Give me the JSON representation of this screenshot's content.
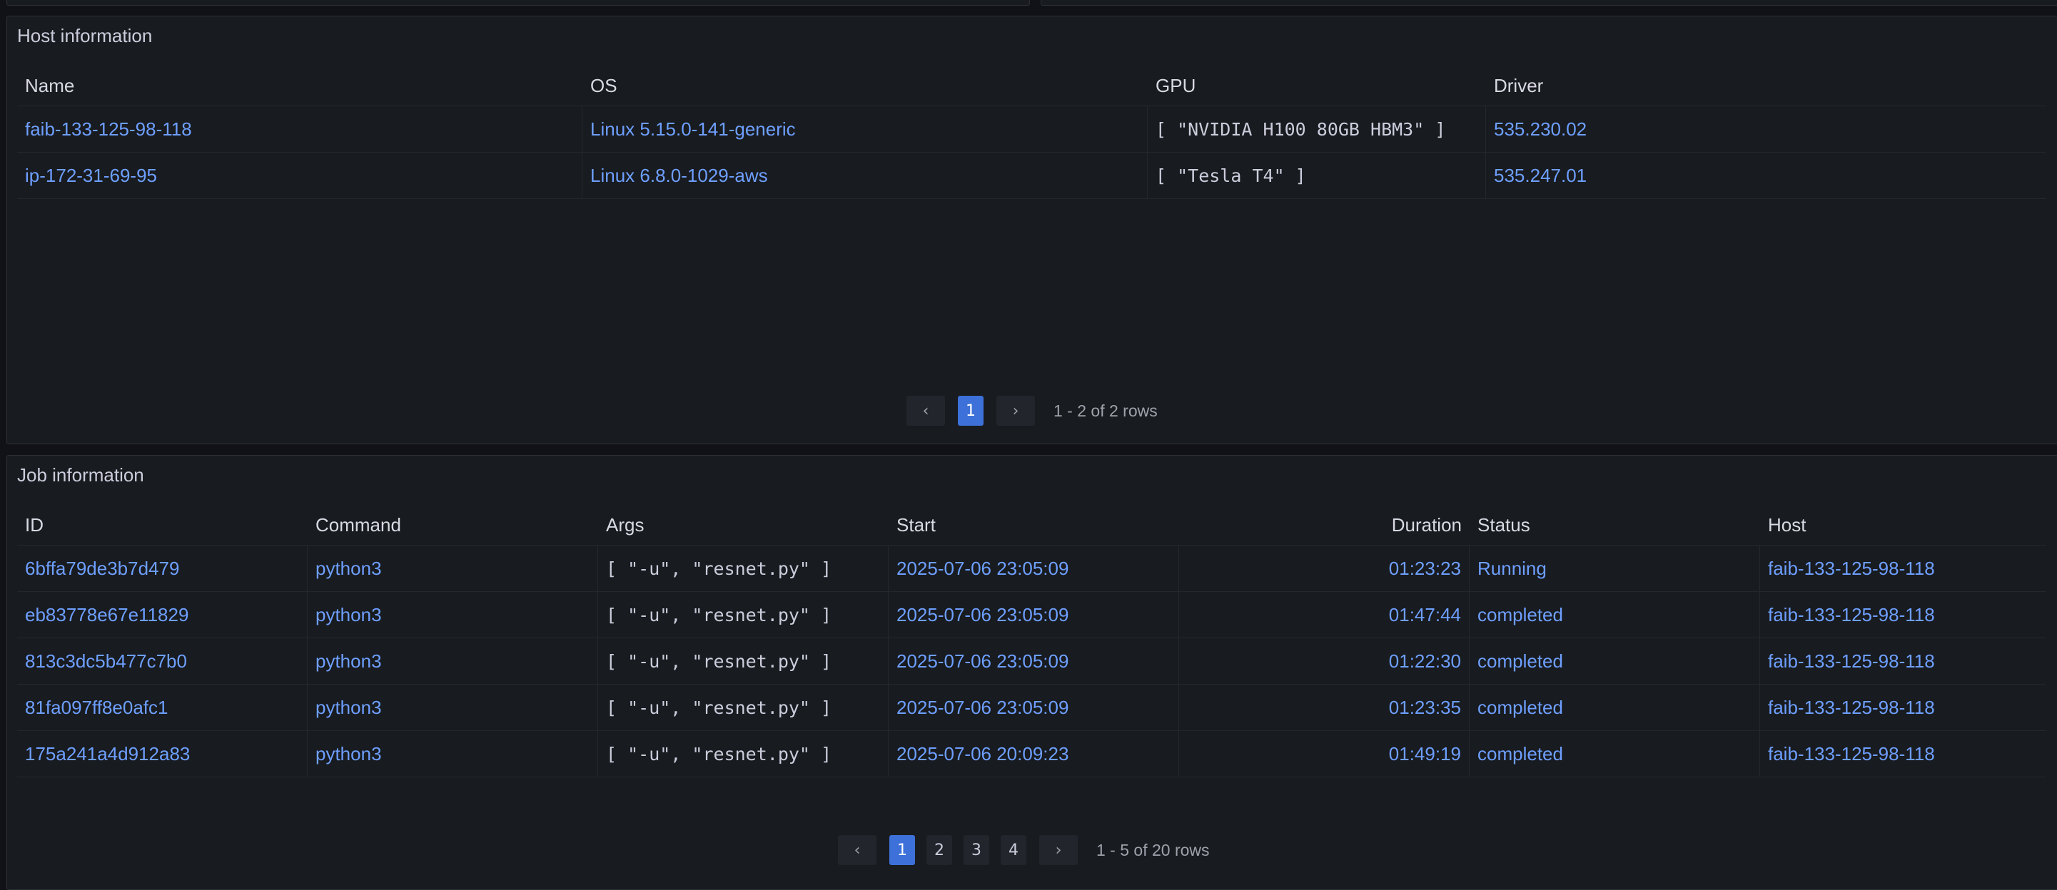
{
  "host_panel": {
    "title": "Host information",
    "columns": [
      "Name",
      "OS",
      "GPU",
      "Driver"
    ],
    "rows": [
      {
        "name": "faib-133-125-98-118",
        "os": "Linux 5.15.0-141-generic",
        "gpu": "[ \"NVIDIA H100 80GB HBM3\" ]",
        "driver": "535.230.02"
      },
      {
        "name": "ip-172-31-69-95",
        "os": "Linux 6.8.0-1029-aws",
        "gpu": "[ \"Tesla T4\" ]",
        "driver": "535.247.01"
      }
    ],
    "pager": {
      "prev": "‹",
      "next": "›",
      "pages": [
        "1"
      ],
      "active": "1",
      "info": "1 - 2 of 2 rows"
    }
  },
  "job_panel": {
    "title": "Job information",
    "columns": [
      "ID",
      "Command",
      "Args",
      "Start",
      "Duration",
      "Status",
      "Host"
    ],
    "rows": [
      {
        "id": "6bffa79de3b7d479",
        "command": "python3",
        "args": "[ \"-u\", \"resnet.py\" ]",
        "start": "2025-07-06 23:05:09",
        "duration": "01:23:23",
        "status": "Running",
        "host": "faib-133-125-98-118"
      },
      {
        "id": "eb83778e67e11829",
        "command": "python3",
        "args": "[ \"-u\", \"resnet.py\" ]",
        "start": "2025-07-06 23:05:09",
        "duration": "01:47:44",
        "status": "completed",
        "host": "faib-133-125-98-118"
      },
      {
        "id": "813c3dc5b477c7b0",
        "command": "python3",
        "args": "[ \"-u\", \"resnet.py\" ]",
        "start": "2025-07-06 23:05:09",
        "duration": "01:22:30",
        "status": "completed",
        "host": "faib-133-125-98-118"
      },
      {
        "id": "81fa097ff8e0afc1",
        "command": "python3",
        "args": "[ \"-u\", \"resnet.py\" ]",
        "start": "2025-07-06 23:05:09",
        "duration": "01:23:35",
        "status": "completed",
        "host": "faib-133-125-98-118"
      },
      {
        "id": "175a241a4d912a83",
        "command": "python3",
        "args": "[ \"-u\", \"resnet.py\" ]",
        "start": "2025-07-06 20:09:23",
        "duration": "01:49:19",
        "status": "completed",
        "host": "faib-133-125-98-118"
      }
    ],
    "pager": {
      "prev": "‹",
      "next": "›",
      "pages": [
        "1",
        "2",
        "3",
        "4"
      ],
      "active": "1",
      "info": "1 - 5 of 20 rows"
    }
  },
  "colors": {
    "background": "#111217",
    "panel": "#181b1f",
    "link": "#6e9fff",
    "active_page": "#3d71d9"
  }
}
